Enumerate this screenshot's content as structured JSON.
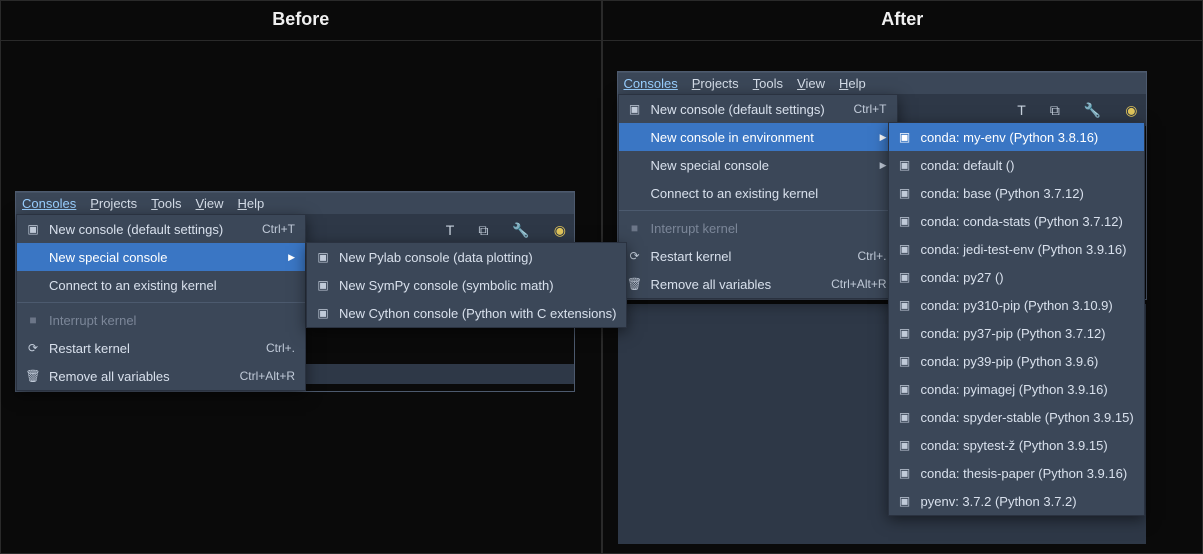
{
  "headers": {
    "before": "Before",
    "after": "After"
  },
  "menubar": {
    "consoles": "Consoles",
    "projects": "Projects",
    "tools": "Tools",
    "view": "View",
    "help": "Help"
  },
  "menu_before": {
    "new_default": "New console (default settings)",
    "new_default_sc": "Ctrl+T",
    "new_special": "New special console",
    "connect": "Connect to an existing kernel",
    "interrupt": "Interrupt kernel",
    "restart": "Restart kernel",
    "restart_sc": "Ctrl+.",
    "remove_all": "Remove all variables",
    "remove_all_sc": "Ctrl+Alt+R"
  },
  "submenu_before": {
    "pylab": "New Pylab console (data plotting)",
    "sympy": "New SymPy console (symbolic math)",
    "cython": "New Cython console (Python with C extensions)"
  },
  "menu_after": {
    "new_default": "New console (default settings)",
    "new_default_sc": "Ctrl+T",
    "new_env": "New console in environment",
    "new_special": "New special console",
    "connect": "Connect to an existing kernel",
    "interrupt": "Interrupt kernel",
    "restart": "Restart kernel",
    "restart_sc": "Ctrl+.",
    "remove_all": "Remove all variables",
    "remove_all_sc": "Ctrl+Alt+R"
  },
  "env_list": [
    "conda: my-env (Python 3.8.16)",
    "conda: default ()",
    "conda: base (Python 3.7.12)",
    "conda: conda-stats (Python 3.7.12)",
    "conda: jedi-test-env (Python 3.9.16)",
    "conda: py27 ()",
    "conda: py310-pip (Python 3.10.9)",
    "conda: py37-pip (Python 3.7.12)",
    "conda: py39-pip (Python 3.9.6)",
    "conda: pyimagej (Python 3.9.16)",
    "conda: spyder-stable (Python 3.9.15)",
    "conda: spytest-ž (Python 3.9.15)",
    "conda: thesis-paper (Python 3.9.16)",
    "pyenv: 3.7.2 (Python 3.7.2)"
  ]
}
